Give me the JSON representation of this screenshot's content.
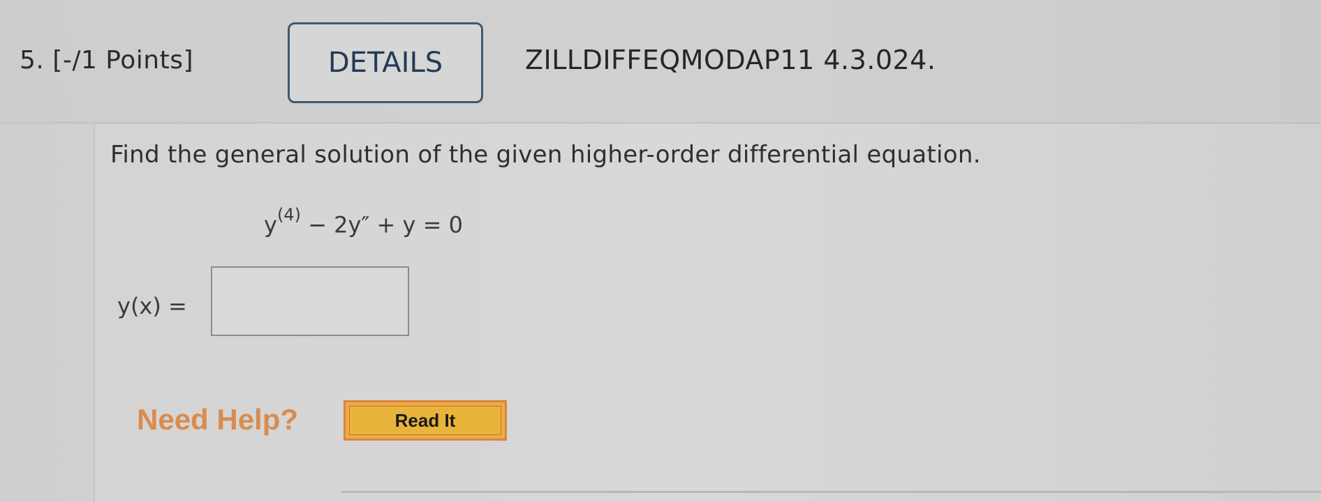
{
  "question": {
    "number_points": "5. [-/1 Points]",
    "details_label": "DETAILS",
    "problem_code": "ZILLDIFFEQMODAP11 4.3.024."
  },
  "problem": {
    "prompt": "Find the general solution of the given higher-order differential equation.",
    "equation": {
      "lhs_base": "y",
      "lhs_sup": "(4)",
      "rest": " − 2y″ + y = 0"
    },
    "answer_label": "y(x) =",
    "answer_value": ""
  },
  "help": {
    "need_help_label": "Need Help?",
    "read_it_label": "Read It"
  },
  "colors": {
    "details_border": "#3d5a6e",
    "need_help_text": "#d98c4e",
    "read_it_fill": "#e9b43a"
  }
}
